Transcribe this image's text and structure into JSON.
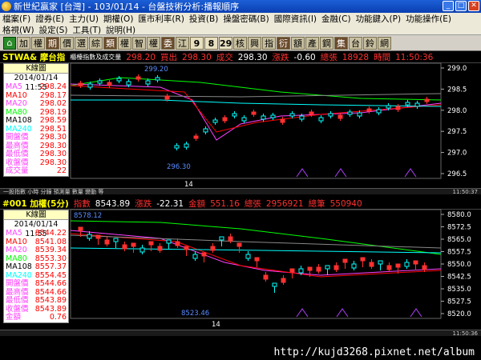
{
  "titlebar": {
    "title": "新世紀贏家 [台灣] - 103/01/14 - 台盤技術分析:播報順序",
    "minimize": "_",
    "maximize": "□",
    "close": "✕"
  },
  "menu": {
    "row1": [
      "檔案(F)",
      "證券(E)",
      "主力(U)",
      "期權(O)",
      "匯市利率(R)",
      "投資(B)",
      "操盤密碼(B)",
      "國際資訊(I)",
      "金融(C)",
      "功能鍵入(P)",
      "功能操作(E)"
    ],
    "row2": [
      "格視(W)",
      "設定(S)",
      "工具(T)",
      "說明(H)"
    ]
  },
  "toolbar": {
    "buttons": [
      "加",
      "權",
      "期",
      "價",
      "選",
      "綜",
      "類",
      "權",
      "智",
      "權",
      "委",
      "江",
      "9",
      "8",
      "29",
      "核",
      "興",
      "指",
      "衍",
      "額",
      "產",
      "鋼",
      "集",
      "台",
      "鈴",
      "網"
    ]
  },
  "panel1": {
    "symbol": "STWA& 摩台指",
    "sub": "櫃檯指數及成交量",
    "bid": "298.20",
    "bid_label": "買出",
    "ask": "298.30",
    "ask_label": "成交",
    "last": "298.30",
    "change_label": "漲跌",
    "change": "-0.60",
    "vol_label": "總張",
    "volume": "18928",
    "time_label": "時間",
    "time": "11:50:36",
    "info_title": "K線圖",
    "info_date": "2014/01/14  11:55",
    "rows": [
      {
        "k": "MA5",
        "v": "298.24",
        "c": "#ff40ff"
      },
      {
        "k": "MA10",
        "v": "298.17",
        "c": "#ff0000"
      },
      {
        "k": "MA20",
        "v": "298.02",
        "c": "#ff40ff"
      },
      {
        "k": "MA80",
        "v": "298.19",
        "c": "#00ff00"
      },
      {
        "k": "MA108",
        "v": "298.59",
        "c": "#000000"
      },
      {
        "k": "MA240",
        "v": "298.51",
        "c": "#00ffff"
      },
      {
        "k": "開盤價",
        "v": "298.30",
        "c": "#ff40ff"
      },
      {
        "k": "最高價",
        "v": "298.30",
        "c": "#ff40ff"
      },
      {
        "k": "最低價",
        "v": "298.30",
        "c": "#ff40ff"
      },
      {
        "k": "收盤價",
        "v": "298.30",
        "c": "#ff40ff"
      },
      {
        "k": "成交量",
        "v": "22",
        "c": "#ff40ff"
      }
    ],
    "high_label": "299.20",
    "low_label": "296.30",
    "xtick": "14",
    "yticks": [
      "299.0",
      "298.5",
      "298.0",
      "297.5",
      "297.0",
      "296.5"
    ],
    "status_left": "一股指數 小時 分鐘 預測量 數量 變動 等",
    "status_right": "11:50:37"
  },
  "panel2": {
    "symbol": "#001 加權(5分)",
    "index_label": "指數",
    "index": "8543.89",
    "change_label": "漲跌",
    "change": "-22.31",
    "amount_label": "金額",
    "amount": "551.16",
    "vol_label": "總張",
    "volume": "2956921",
    "count_label": "總筆",
    "count": "550940",
    "info_title": "K線圖",
    "info_date": "2014/01/14  11:55",
    "rows": [
      {
        "k": "MA5",
        "v": "8544.22",
        "c": "#ff40ff"
      },
      {
        "k": "MA10",
        "v": "8541.08",
        "c": "#ff0000"
      },
      {
        "k": "MA20",
        "v": "8539.34",
        "c": "#ff40ff"
      },
      {
        "k": "MA80",
        "v": "8553.30",
        "c": "#00ff00"
      },
      {
        "k": "MA108",
        "v": "8557.37",
        "c": "#000000"
      },
      {
        "k": "MA240",
        "v": "8554.45",
        "c": "#00ffff"
      },
      {
        "k": "開盤價",
        "v": "8544.66",
        "c": "#ff40ff"
      },
      {
        "k": "最高價",
        "v": "8544.66",
        "c": "#ff40ff"
      },
      {
        "k": "最低價",
        "v": "8543.89",
        "c": "#ff40ff"
      },
      {
        "k": "收盤價",
        "v": "8543.89",
        "c": "#ff40ff"
      },
      {
        "k": "金額",
        "v": "0.76",
        "c": "#ff40ff"
      }
    ],
    "high_label": "8578.12",
    "low_label": "8523.46",
    "xtick": "14",
    "yticks": [
      "8580.0",
      "8572.5",
      "8565.0",
      "8557.5",
      "8550.0",
      "8542.5",
      "8535.0",
      "8527.5",
      "8520.0"
    ],
    "status_right": "11:50:36"
  },
  "watermark": "http://kujd3268.pixnet.net/album"
}
